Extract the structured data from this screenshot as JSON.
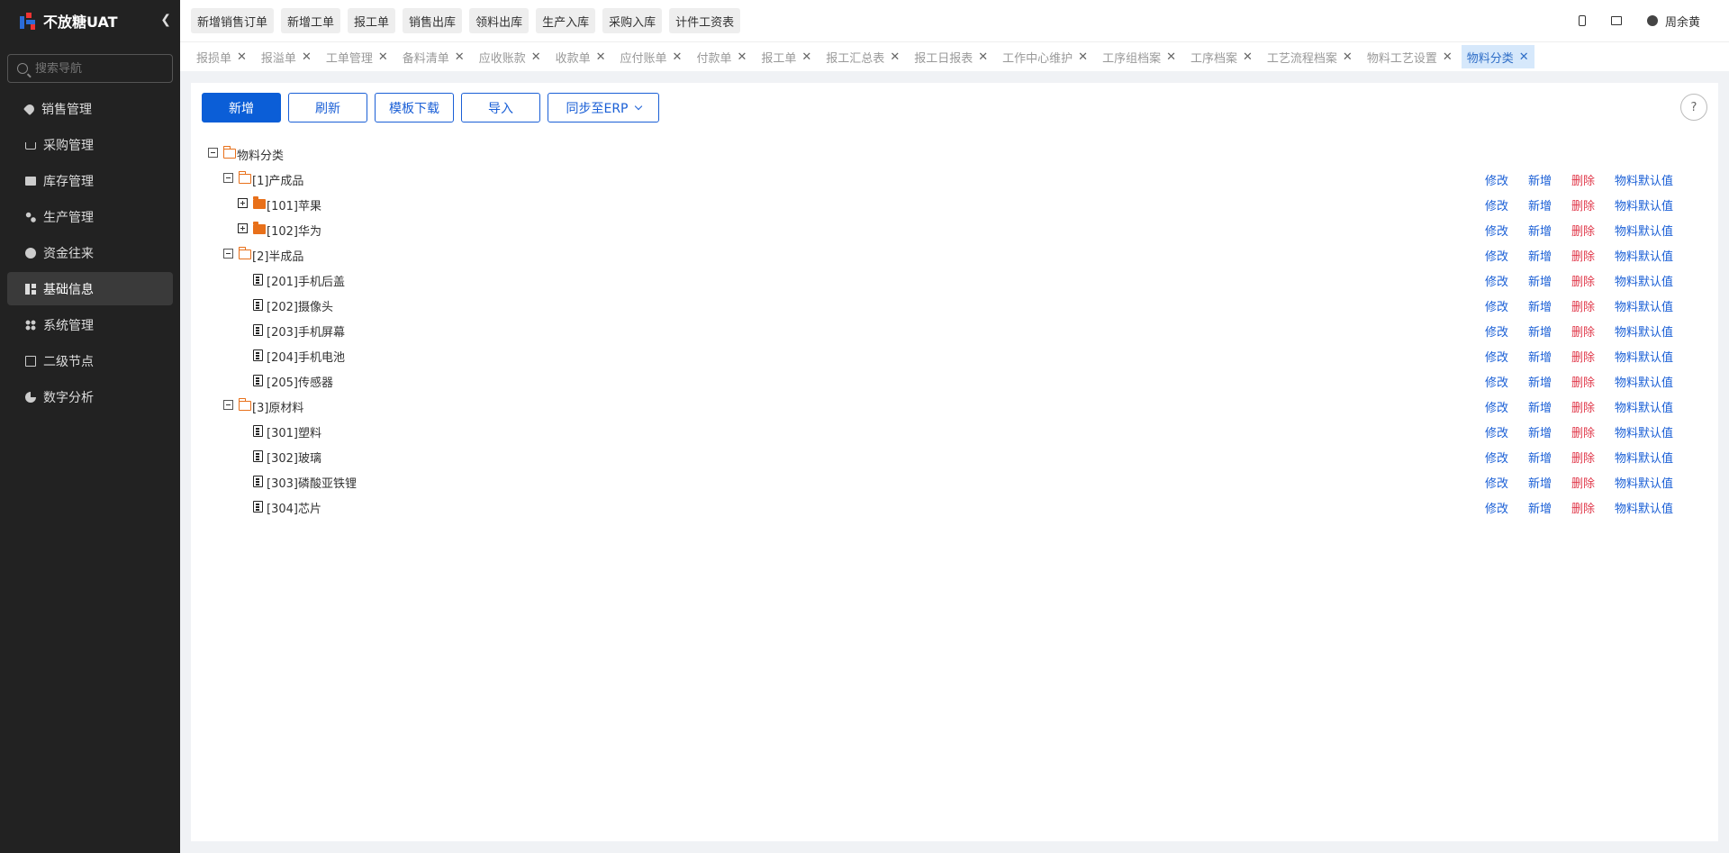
{
  "app": {
    "name": "不放糖UAT"
  },
  "sidebar": {
    "search_placeholder": "搜索导航",
    "items": [
      {
        "label": "销售管理",
        "icon": "tag-icon"
      },
      {
        "label": "采购管理",
        "icon": "cart-icon"
      },
      {
        "label": "库存管理",
        "icon": "box-icon"
      },
      {
        "label": "生产管理",
        "icon": "nodes-icon"
      },
      {
        "label": "资金往来",
        "icon": "coin-icon"
      },
      {
        "label": "基础信息",
        "icon": "grid-icon",
        "active": true
      },
      {
        "label": "系统管理",
        "icon": "apps-icon"
      },
      {
        "label": "二级节点",
        "icon": "list-icon"
      },
      {
        "label": "数字分析",
        "icon": "pie-icon"
      }
    ]
  },
  "quicklinks": [
    "新增销售订单",
    "新增工单",
    "报工单",
    "销售出库",
    "领料出库",
    "生产入库",
    "采购入库",
    "计件工资表"
  ],
  "user": {
    "name": "周余黄"
  },
  "tabs": [
    {
      "label": "报损单"
    },
    {
      "label": "报溢单"
    },
    {
      "label": "工单管理"
    },
    {
      "label": "备料清单"
    },
    {
      "label": "应收账款"
    },
    {
      "label": "收款单"
    },
    {
      "label": "应付账单"
    },
    {
      "label": "付款单"
    },
    {
      "label": "报工单"
    },
    {
      "label": "报工汇总表"
    },
    {
      "label": "报工日报表"
    },
    {
      "label": "工作中心维护"
    },
    {
      "label": "工序组档案"
    },
    {
      "label": "工序档案"
    },
    {
      "label": "工艺流程档案"
    },
    {
      "label": "物料工艺设置"
    },
    {
      "label": "物料分类",
      "active": true
    }
  ],
  "toolbar": {
    "add": "新增",
    "refresh": "刷新",
    "template_download": "模板下载",
    "import": "导入",
    "sync_erp": "同步至ERP"
  },
  "help": "?",
  "actions": {
    "edit": "修改",
    "add": "新增",
    "delete": "删除",
    "defaults": "物料默认值"
  },
  "tree": {
    "root": "物料分类",
    "nodes": [
      {
        "label": "[1]产成品",
        "level": 1,
        "type": "folder-open",
        "toggle": "minus",
        "actions": true
      },
      {
        "label": "[101]苹果",
        "level": 2,
        "type": "folder-closed",
        "toggle": "plus",
        "actions": true
      },
      {
        "label": "[102]华为",
        "level": 2,
        "type": "folder-closed",
        "toggle": "plus",
        "actions": true
      },
      {
        "label": "[2]半成品",
        "level": 1,
        "type": "folder-open",
        "toggle": "minus",
        "actions": true
      },
      {
        "label": "[201]手机后盖",
        "level": 2,
        "type": "doc",
        "actions": true
      },
      {
        "label": "[202]摄像头",
        "level": 2,
        "type": "doc",
        "actions": true
      },
      {
        "label": "[203]手机屏幕",
        "level": 2,
        "type": "doc",
        "actions": true
      },
      {
        "label": "[204]手机电池",
        "level": 2,
        "type": "doc",
        "actions": true
      },
      {
        "label": "[205]传感器",
        "level": 2,
        "type": "doc",
        "actions": true
      },
      {
        "label": "[3]原材料",
        "level": 1,
        "type": "folder-open",
        "toggle": "minus",
        "actions": true
      },
      {
        "label": "[301]塑料",
        "level": 2,
        "type": "doc",
        "actions": true
      },
      {
        "label": "[302]玻璃",
        "level": 2,
        "type": "doc",
        "actions": true
      },
      {
        "label": "[303]磷酸亚铁锂",
        "level": 2,
        "type": "doc",
        "actions": true
      },
      {
        "label": "[304]芯片",
        "level": 2,
        "type": "doc",
        "actions": true
      }
    ]
  }
}
